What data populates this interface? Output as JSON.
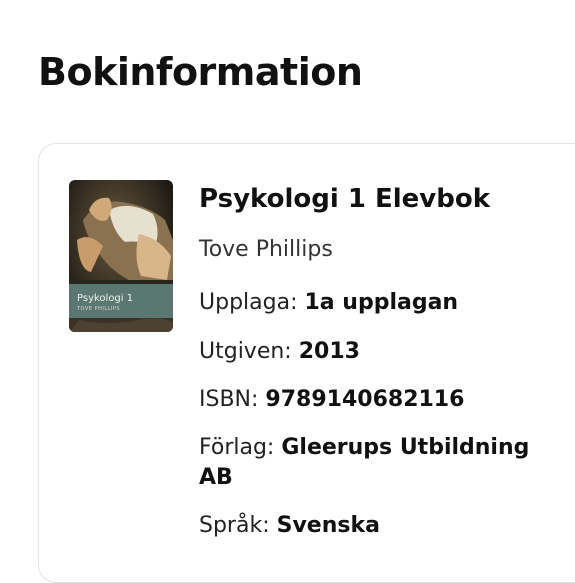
{
  "page": {
    "title": "Bokinformation"
  },
  "book": {
    "title": "Psykologi 1 Elevbok",
    "author": "Tove Phillips",
    "cover": {
      "title": "Psykologi 1",
      "author": "TOVE PHILLIPS",
      "band_color": "#5e7f78"
    },
    "details": [
      {
        "label": "Upplaga:",
        "value": "1a upplagan"
      },
      {
        "label": "Utgiven:",
        "value": "2013"
      },
      {
        "label": "ISBN:",
        "value": "9789140682116"
      },
      {
        "label": "Förlag:",
        "value": "Gleerups Utbildning AB"
      },
      {
        "label": "Språk:",
        "value": "Svenska"
      }
    ]
  }
}
